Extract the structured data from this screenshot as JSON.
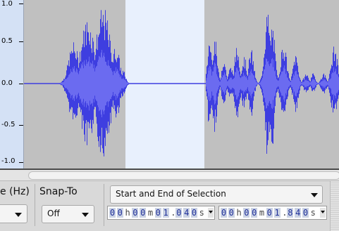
{
  "ruler": {
    "ticks": [
      "1.0",
      "0.5",
      "0.0",
      "-0.5",
      "-1.0"
    ]
  },
  "waveform": {
    "selection_start_s": 1.04,
    "selection_end_s": 1.84,
    "wave_color": "#3e3ee0",
    "background_color": "#c0c0c0",
    "selection_color": "#e8f0fd"
  },
  "toolbar": {
    "rate_label": "e (Hz)",
    "snap_label": "Snap-To",
    "snap_value": "Off",
    "selection_mode": "Start and End of Selection",
    "start_time": [
      "0",
      "0",
      "h",
      "0",
      "0",
      "m",
      "0",
      "1",
      ".",
      "0",
      "4",
      "0",
      "s"
    ],
    "end_time": [
      "0",
      "0",
      "h",
      "0",
      "0",
      "m",
      "0",
      "1",
      ".",
      "8",
      "4",
      "0",
      "s"
    ]
  }
}
